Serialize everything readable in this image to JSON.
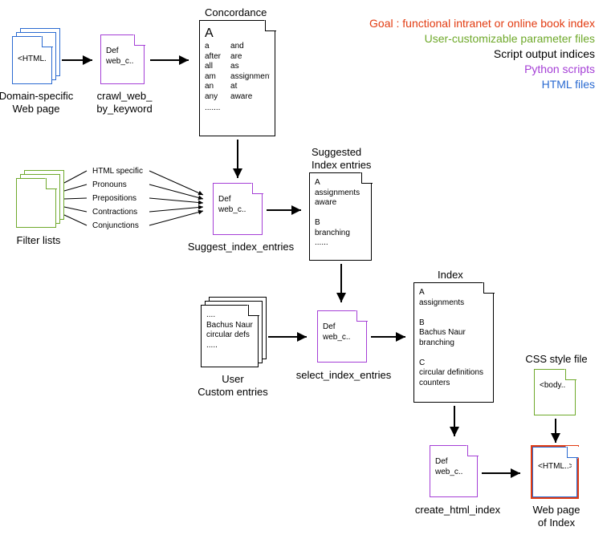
{
  "legend": {
    "goal": "Goal : functional intranet or online book index",
    "param": "User-customizable parameter files",
    "output": "Script output indices",
    "py": "Python scripts",
    "html": "HTML files"
  },
  "nodes": {
    "domain_page": {
      "label": "Domain-specific\nWeb page",
      "snippet": "<HTML..>"
    },
    "crawl": {
      "label": "crawl_web_\nby_keyword",
      "snippet": "Def web_c.."
    },
    "concordance": {
      "label": "Concordance",
      "heading": "A",
      "col1": "a\nafter\nall\nam\nan\nany",
      "col2": "and\nare\nas\nassignments\nat\naware",
      "dots": "......."
    },
    "filter_lists": {
      "label": "Filter lists",
      "lines": [
        "HTML specific",
        "Pronouns",
        "Prepositions",
        "Contractions",
        "Conjunctions"
      ]
    },
    "suggest": {
      "label": "Suggest_index_entries",
      "snippet": "Def web_c.."
    },
    "suggested": {
      "label": "Suggested\nIndex entries",
      "body": "A\nassignments\naware\n\nB\nbranching\n......"
    },
    "user_custom": {
      "label": "User\nCustom entries",
      "body": "....\nBachus Naur\ncircular defs\n....."
    },
    "select": {
      "label": "select_index_entries",
      "snippet": "Def web_c.."
    },
    "index": {
      "label": "Index",
      "body": "A\nassignments\n\nB\nBachus Naur\nbranching\n\nC\ncircular definitions\ncounters"
    },
    "css_file": {
      "label": "CSS style file",
      "snippet": "<body.."
    },
    "create_html": {
      "label": "create_html_index",
      "snippet": "Def web_c.."
    },
    "webpage_index": {
      "label": "Web page\nof Index",
      "snippet": "<HTML..>"
    }
  }
}
